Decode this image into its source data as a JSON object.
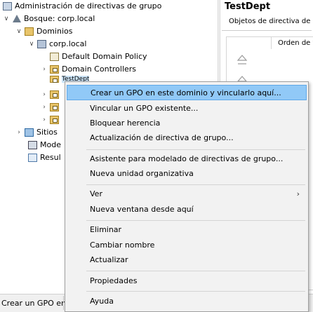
{
  "tree": {
    "root_label": "Administración de directivas de grupo",
    "forest_label": "Bosque: corp.local",
    "domains_label": "Dominios",
    "domain_label": "corp.local",
    "default_policy_label": "Default Domain Policy",
    "dc_label": "Domain Controllers",
    "selected_label": "TestDept",
    "sites_label": "Sitios",
    "modeling_label": "Mode",
    "results_label": "Resul"
  },
  "right_pane": {
    "title": "TestDept",
    "tab_label": "Objetos de directiva de g",
    "column_header": "Orden de v"
  },
  "status_bar": {
    "text": "Crear un GPO en"
  },
  "context_menu": {
    "items": [
      {
        "label": "Crear un GPO en este dominio y vincularlo aquí..."
      },
      {
        "label": "Vincular un GPO existente..."
      },
      {
        "label": "Bloquear herencia"
      },
      {
        "label": "Actualización de directiva de grupo..."
      },
      {
        "label": "Asistente para modelado de directivas de grupo..."
      },
      {
        "label": "Nueva unidad organizativa"
      },
      {
        "label": "Ver",
        "submenu_arrow": "›"
      },
      {
        "label": "Nueva ventana desde aquí"
      },
      {
        "label": "Eliminar"
      },
      {
        "label": "Cambiar nombre"
      },
      {
        "label": "Actualizar"
      },
      {
        "label": "Propiedades"
      },
      {
        "label": "Ayuda"
      }
    ]
  },
  "colors": {
    "menu_highlight": "#91c9f7",
    "menu_background": "#f2f2f2"
  }
}
